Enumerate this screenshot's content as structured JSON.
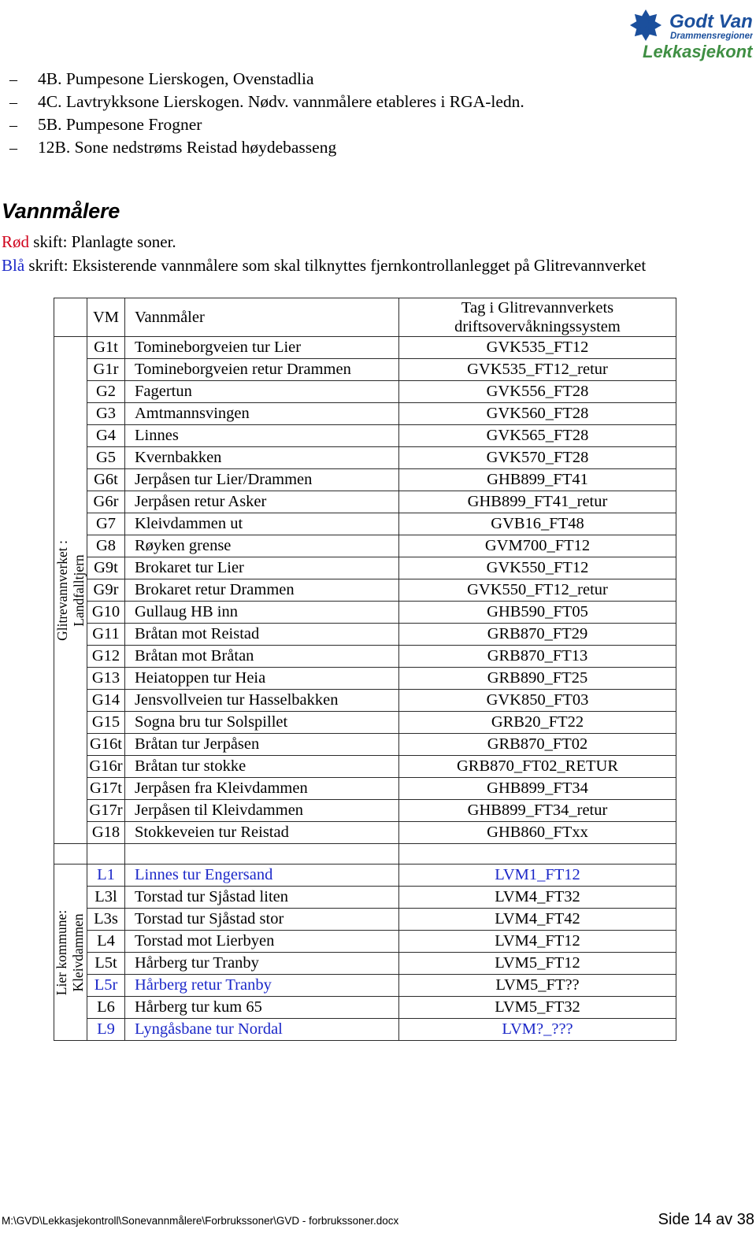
{
  "logo": {
    "icon": "water-droplet-circle-icon",
    "brand_line1": "Godt Vann",
    "brand_line2": "Drammensregionen",
    "brand_line3": "Lekkasjekontroll",
    "brand_blue": "#1b4f9c",
    "brand_green": "#3f8f43"
  },
  "bullets": [
    {
      "marker": "–",
      "text": "4B. Pumpesone Lierskogen, Ovenstadlia"
    },
    {
      "marker": "–",
      "text": "4C. Lavtrykksone Lierskogen. Nødv. vannmålere etableres i RGA-ledn."
    },
    {
      "marker": "–",
      "text": "5B. Pumpesone Frogner"
    },
    {
      "marker": "–",
      "text": "12B. Sone nedstrøms Reistad høydebasseng"
    }
  ],
  "heading": "Vannmålere",
  "legend": {
    "red_word": "Rød",
    "red_rest": " skift: Planlagte soner.",
    "blue_word": "Blå",
    "blue_rest": " skrift:  Eksisterende vannmålere som skal tilknyttes fjernkontrollanlegget på Glitrevannverket",
    "red_color": "#d0021b",
    "blue_color": "#1b27c8"
  },
  "table": {
    "headers": {
      "group": "",
      "vm": "VM",
      "name": "Vannmåler",
      "tag_line1": "Tag i Glitrevannverkets",
      "tag_line2": "driftsovervåkningssystem"
    },
    "groups": [
      {
        "label_line1": "Glitrevannverket :",
        "label_line2": "Landfalltjern",
        "rows": [
          {
            "vm": "G1t",
            "name": "Tomineborgveien tur Lier",
            "tag": "GVK535_FT12",
            "blue": false
          },
          {
            "vm": "G1r",
            "name": "Tomineborgveien retur Drammen",
            "tag": "GVK535_FT12_retur",
            "blue": false
          },
          {
            "vm": "G2",
            "name": "Fagertun",
            "tag": "GVK556_FT28",
            "blue": false
          },
          {
            "vm": "G3",
            "name": "Amtmannsvingen",
            "tag": "GVK560_FT28",
            "blue": false
          },
          {
            "vm": "G4",
            "name": "Linnes",
            "tag": "GVK565_FT28",
            "blue": false
          },
          {
            "vm": "G5",
            "name": "Kvernbakken",
            "tag": "GVK570_FT28",
            "blue": false
          },
          {
            "vm": "G6t",
            "name": "Jerpåsen tur Lier/Drammen",
            "tag": "GHB899_FT41",
            "blue": false
          },
          {
            "vm": "G6r",
            "name": "Jerpåsen retur Asker",
            "tag": "GHB899_FT41_retur",
            "blue": false
          },
          {
            "vm": "G7",
            "name": "Kleivdammen ut",
            "tag": "GVB16_FT48",
            "blue": false
          },
          {
            "vm": "G8",
            "name": "Røyken grense",
            "tag": "GVM700_FT12",
            "blue": false
          },
          {
            "vm": "G9t",
            "name": "Brokaret tur Lier",
            "tag": "GVK550_FT12",
            "blue": false
          },
          {
            "vm": "G9r",
            "name": "Brokaret retur Drammen",
            "tag": "GVK550_FT12_retur",
            "blue": false
          },
          {
            "vm": "G10",
            "name": "Gullaug HB inn",
            "tag": "GHB590_FT05",
            "blue": false
          },
          {
            "vm": "G11",
            "name": "Bråtan mot Reistad",
            "tag": "GRB870_FT29",
            "blue": false
          },
          {
            "vm": "G12",
            "name": "Bråtan mot Bråtan",
            "tag": "GRB870_FT13",
            "blue": false
          },
          {
            "vm": "G13",
            "name": "Heiatoppen tur Heia",
            "tag": "GRB890_FT25",
            "blue": false
          },
          {
            "vm": "G14",
            "name": "Jensvollveien tur Hasselbakken",
            "tag": "GVK850_FT03",
            "blue": false
          },
          {
            "vm": "G15",
            "name": "Sogna bru tur Solspillet",
            "tag": "GRB20_FT22",
            "blue": false
          },
          {
            "vm": "G16t",
            "name": "Bråtan  tur Jerpåsen",
            "tag": "GRB870_FT02",
            "blue": false
          },
          {
            "vm": "G16r",
            "name": "Bråtan  tur stokke",
            "tag": "GRB870_FT02_RETUR",
            "blue": false
          },
          {
            "vm": "G17t",
            "name": "Jerpåsen fra Kleivdammen",
            "tag": "GHB899_FT34",
            "blue": false
          },
          {
            "vm": "G17r",
            "name": "Jerpåsen til Kleivdammen",
            "tag": "GHB899_FT34_retur",
            "blue": false
          },
          {
            "vm": "G18",
            "name": "Stokkeveien tur Reistad",
            "tag": "GHB860_FTxx",
            "blue": false
          }
        ]
      },
      {
        "label_line1": "Lier  kommune:",
        "label_line2": "Kleivdammen",
        "rows": [
          {
            "vm": "L1",
            "name": "Linnes tur Engersand",
            "tag": "LVM1_FT12",
            "blue": true,
            "tag_blue": true
          },
          {
            "vm": "L3l",
            "name": "Torstad tur Sjåstad liten",
            "tag": "LVM4_FT32",
            "blue": false,
            "tag_blue": false
          },
          {
            "vm": "L3s",
            "name": "Torstad tur Sjåstad stor",
            "tag": "LVM4_FT42",
            "blue": false,
            "tag_blue": false
          },
          {
            "vm": "L4",
            "name": "Torstad mot Lierbyen",
            "tag": "LVM4_FT12",
            "blue": false,
            "tag_blue": false
          },
          {
            "vm": "L5t",
            "name": "Hårberg tur Tranby",
            "tag": "LVM5_FT12",
            "blue": false,
            "tag_blue": false
          },
          {
            "vm": "L5r",
            "name": "Hårberg retur Tranby",
            "tag": "LVM5_FT??",
            "blue": true,
            "tag_blue": false
          },
          {
            "vm": "L6",
            "name": "Hårberg tur kum 65",
            "tag": "LVM5_FT32",
            "blue": false,
            "tag_blue": false
          },
          {
            "vm": "L9",
            "name": "Lyngåsbane tur Nordal",
            "tag": "LVM?_???",
            "blue": true,
            "tag_blue": true
          }
        ]
      }
    ]
  },
  "footer": {
    "path": "M:\\GVD\\Lekkasjekontroll\\Sonevannmålere\\Forbrukssoner\\GVD - forbrukssoner.docx",
    "page": "Side 14 av 38"
  }
}
